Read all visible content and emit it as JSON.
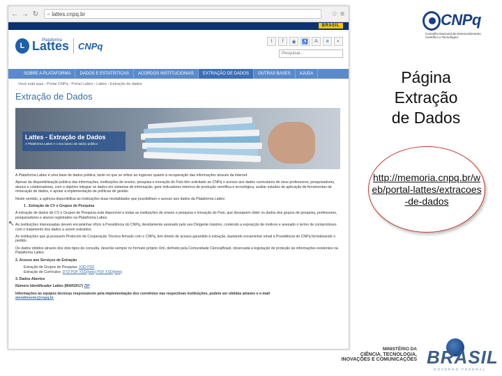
{
  "browser": {
    "url": "lattes.cnpq.br",
    "gov_bar_label": "BRASIL"
  },
  "site": {
    "logo_prefix": "Plataforma",
    "logo_name": "Lattes",
    "partner": "CNPq",
    "search_placeholder": "Pesquisar...",
    "menu": [
      {
        "label": "SOBRE A PLATAFORMA",
        "active": false
      },
      {
        "label": "DADOS E ESTATÍSTICAS",
        "active": false
      },
      {
        "label": "ACORDOS INSTITUCIONAIS",
        "active": false
      },
      {
        "label": "EXTRAÇÃO DE DADOS",
        "active": true
      },
      {
        "label": "OUTRAS BASES",
        "active": false
      },
      {
        "label": "AJUDA",
        "active": false
      }
    ],
    "breadcrumb": "Você está aqui  ›  Portal CNPq  ›  Portal Lattes  ›  Lattes  ›  Extração de dados",
    "page_title": "Extração de Dados",
    "banner_title": "Lattes - Extração de Dados",
    "banner_subtitle": "A Plataforma Lattes e o seu banco de dados público",
    "paragraphs": [
      "A Plataforma Lattes é uma base de dados pública, tanto no que se refere ao ingresso quanto à recuperação das informações através da internet.",
      "Apesar da disponibilização pública das informações, instituições de ensino, pesquisa e inovação do País têm solicitado ao CNPq o acesso aos dados curriculares de seus professores, pesquisadores, alunos e colaboradores, com o objetivo integrar os dados em sistemas de informação, gerir indicadores internos de produção científica e tecnológica, avaliar estudos de aplicação de ferramentas de mineração de dados, e apoiar a implementação de políticas de gestão.",
      "Neste sentido, a agência disponibiliza às instituições duas modalidades que possibilitam o acesso aos dados da Plataforma Lattes:"
    ],
    "section1": "1 . Extração de CV e Grupos de Pesquisa",
    "section1_paragraphs": [
      "A extração de dados de CV e Grupos de Pesquisa está disponível a todas as instituições de ensino e pesquisa e inovação do País, que desejarem obter os dados dos grupos de pesquisa, professores, pesquisadores e alunos registrados na Plataforma Lattes.",
      "As instituições interessadas devem encaminhar ofício à Presidência do CNPq, devidamente assinado pelo seu Dirigente máximo, contendo a exposição de motivos e anexado o termo de compromisso com o tratamento dos dados a serem extraídos.",
      "As instituições que já possuem Protocolo de Cooperação Técnica firmado com o CNPq, tem direito de acesso garantido à extração, bastando encaminhar email à Presidência do CNPq formalizando o pedido.",
      "Os dados obtidos através dos dois tipos de consulta, deverão sempre no formato próprio Xml, definido pela Comunidade CienciaBrasil, observada a legislação de proteção às informações existentes na Plataforma Lattes."
    ],
    "section2": "2. Acesso aos Serviços de Extração",
    "extract_lines": [
      {
        "label": "Extração de Grupos de Pesquisa:",
        "links": "XSD  PDF"
      },
      {
        "label": "Extração de Currículos:",
        "links": "DTD  PDF  XSD(beta)  PDF XSD(beta)"
      }
    ],
    "section3": "3. Dados Abertos",
    "identifier_label": "Número Identificador Lattes (MAR2017)",
    "identifier_link": "ZIP",
    "contact": "Informações às equipes técnicas responsáveis pela implementação dos convênios nas respectivas instituições, podem ser obtidas através o e-mail",
    "contact_email": "atendimento@cnpq.br"
  },
  "slide": {
    "org_name": "CNPq",
    "org_subtitle": "Conselho Nacional de Desenvolvimento Científico e Tecnológico",
    "title_lines": [
      "Página",
      "Extração",
      "de Dados"
    ],
    "url": "http://memoria.cnpq.br/web/portal-lattes/extracoes-de-dados",
    "ministry_label": "MINISTÉRIO DA",
    "ministry_line2": "CIÊNCIA, TECNOLOGIA,",
    "ministry_line3": "INOVAÇÕES E COMUNICAÇÕES",
    "country": "BRASIL",
    "country_motto": "GOVERNO FEDERAL"
  },
  "colors": {
    "menu_bar": "#5a8acb",
    "gov_bar": "#0c326f",
    "oval_border": "#c0392b",
    "title_blue": "#3b6ea5"
  }
}
